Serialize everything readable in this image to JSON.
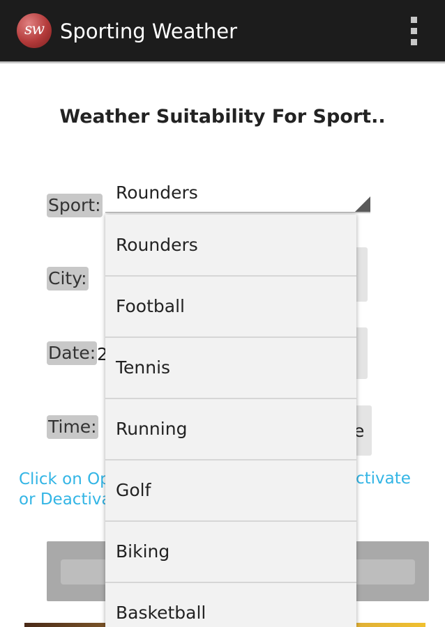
{
  "app": {
    "title": "Sporting Weather",
    "logo_text": "sw"
  },
  "page": {
    "heading": "Weather Suitability For Sport.."
  },
  "form": {
    "sport_label": "Sport:",
    "city_label": "City:",
    "date_label": "Date:",
    "time_label": "Time:",
    "sport_selected": "Rounders",
    "date_value_partial": "2",
    "time_button_partial": "e"
  },
  "hint": {
    "left_line1": "Click on Op",
    "left_line2": "or Deactiva",
    "right_line1": "ctivate"
  },
  "dropdown": {
    "options": [
      "Rounders",
      "Football",
      "Tennis",
      "Running",
      "Golf",
      "Biking",
      "Basketball"
    ]
  },
  "colors": {
    "actionbar": "#1c1c1c",
    "accent": "#33b5e5",
    "logo": "#b33a3a"
  },
  "icons": {
    "menu": "overflow-menu-icon",
    "spinner": "spinner-triangle-icon"
  }
}
